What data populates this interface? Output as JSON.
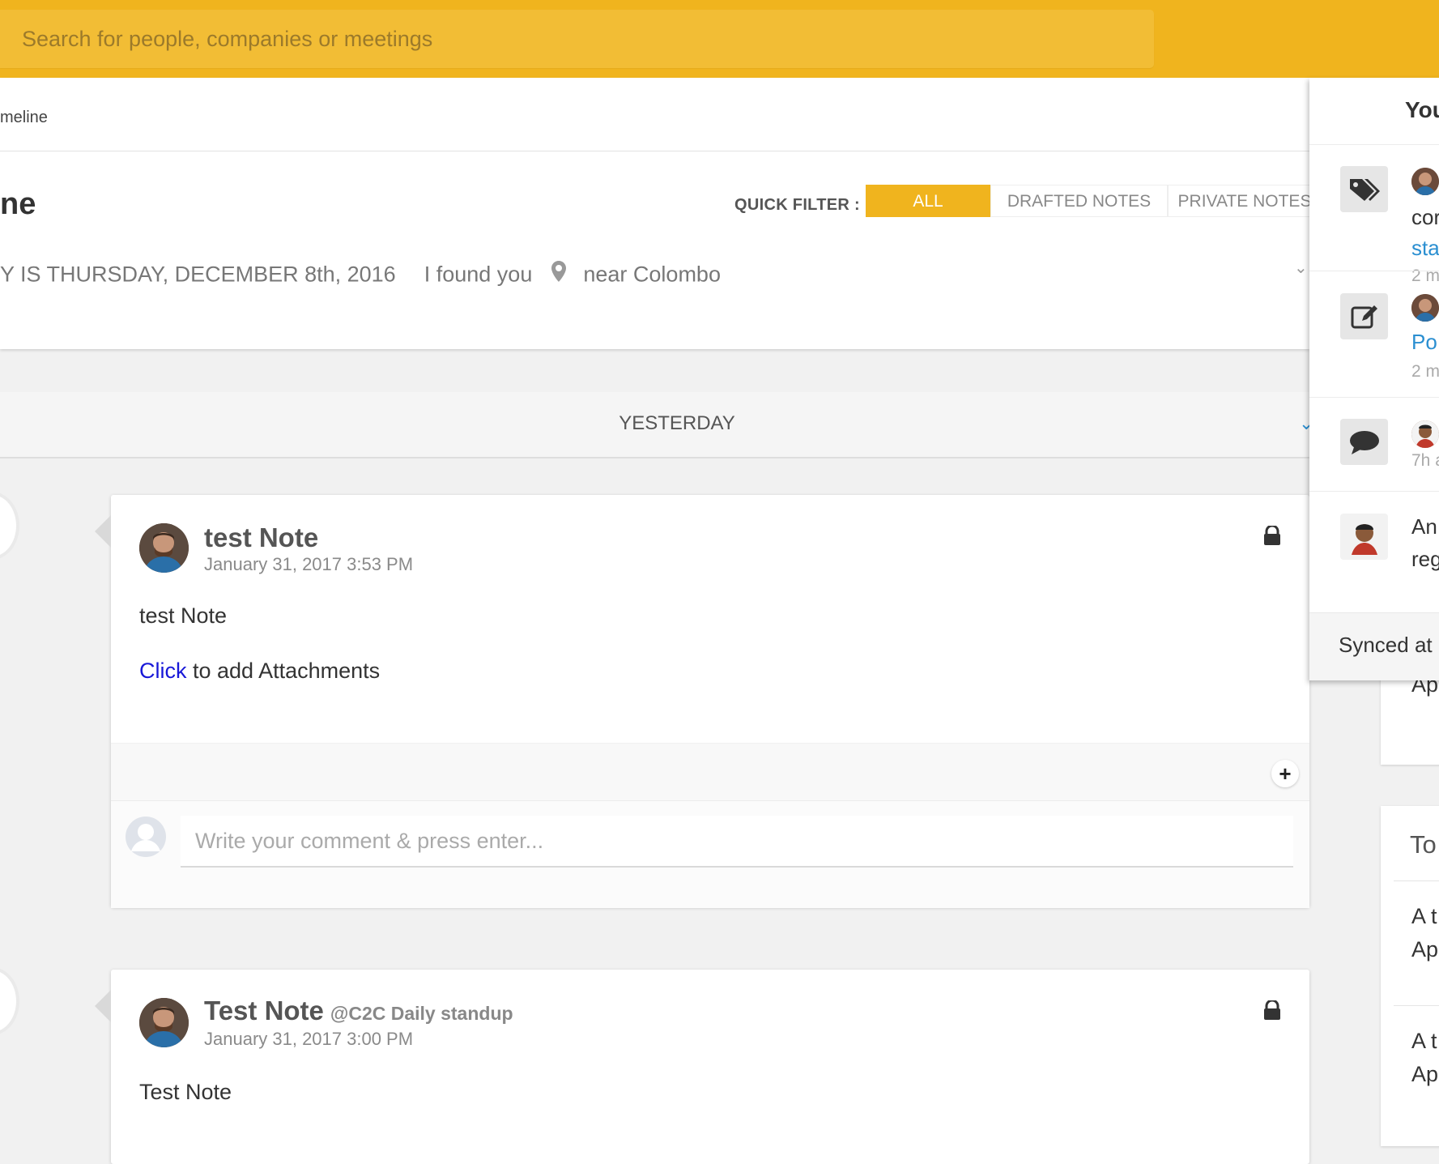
{
  "search": {
    "placeholder": "Search for people, companies or meetings"
  },
  "breadcrumb": "meline",
  "page_title": "ne",
  "quick_filter": {
    "label": "QUICK FILTER :",
    "options": [
      "ALL",
      "DRAFTED NOTES",
      "PRIVATE NOTES"
    ],
    "selected": "ALL"
  },
  "today": {
    "date_text": "Y IS THURSDAY, DECEMBER 8th, 2016",
    "found_text": "I found you",
    "location_text": "near Colombo"
  },
  "timeline": {
    "section_label": "YESTERDAY",
    "notes": [
      {
        "title": "test Note",
        "mention": "",
        "date": "January 31, 2017 3:53 PM",
        "body": "test Note",
        "attach_link": "Click",
        "attach_text": " to add Attachments",
        "comment_placeholder": "Write your comment & press enter..."
      },
      {
        "title": "Test Note",
        "mention": "@C2C Daily standup",
        "date": "January 31, 2017 3:00 PM",
        "body": "Test Note"
      }
    ]
  },
  "notifications": {
    "title": "You",
    "items": [
      {
        "icon": "tags-icon",
        "text": "cor",
        "link": "sta",
        "time": "2 m"
      },
      {
        "icon": "edit-icon",
        "link": "Po",
        "time": "2 m"
      },
      {
        "icon": "comment-icon",
        "time": "7h a"
      },
      {
        "icon": "user-avatar",
        "line1": "An",
        "line2": "reg"
      }
    ],
    "footer": "Synced at"
  },
  "right_column": {
    "peek_text": "Ap",
    "title": "To",
    "items": [
      {
        "line1": "A t",
        "line2": "Ap"
      },
      {
        "line1": "A t",
        "line2": "Ap"
      }
    ]
  },
  "colors": {
    "accent": "#f0b41e",
    "link_blue": "#2b8fd1",
    "attach_link": "#1818d8"
  }
}
